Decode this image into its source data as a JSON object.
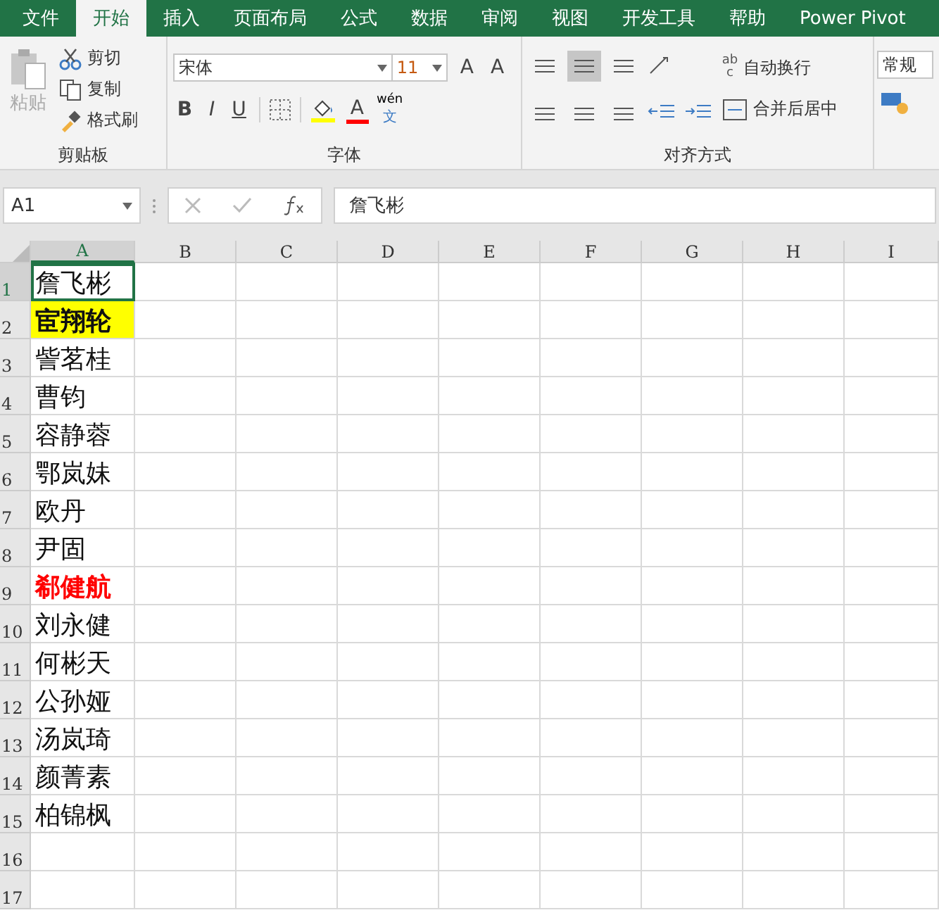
{
  "tabs": [
    {
      "label": "文件",
      "selected": false
    },
    {
      "label": "开始",
      "selected": true
    },
    {
      "label": "插入",
      "selected": false
    },
    {
      "label": "页面布局",
      "selected": false
    },
    {
      "label": "公式",
      "selected": false
    },
    {
      "label": "数据",
      "selected": false
    },
    {
      "label": "审阅",
      "selected": false
    },
    {
      "label": "视图",
      "selected": false
    },
    {
      "label": "开发工具",
      "selected": false
    },
    {
      "label": "帮助",
      "selected": false
    },
    {
      "label": "Power Pivot",
      "selected": false
    }
  ],
  "ribbon": {
    "clipboard": {
      "label": "剪贴板",
      "paste": {
        "label": "粘贴",
        "disabled": true
      },
      "cut": "剪切",
      "copy": "复制",
      "format_painter": "格式刷"
    },
    "font": {
      "label": "字体",
      "font_name": "宋体",
      "font_size": "11",
      "grow": "A",
      "shrink": "A",
      "bold": "B",
      "italic": "I",
      "underline": "U",
      "font_color": "A",
      "phonetic_top": "wén",
      "phonetic_bottom": "文"
    },
    "alignment": {
      "label": "对齐方式",
      "wrap_text": "自动换行",
      "merge_center": "合并后居中",
      "wrap_glyph_top": "ab",
      "wrap_glyph_bottom": "c"
    },
    "number": {
      "format": "常规"
    }
  },
  "name_box": "A1",
  "formula": "詹飞彬",
  "columns": [
    "A",
    "B",
    "C",
    "D",
    "E",
    "F",
    "G",
    "H",
    "I"
  ],
  "rows": [
    {
      "header": "1",
      "value": "詹飞彬",
      "kind": "plain",
      "selected": true
    },
    {
      "header": "2",
      "value": "宦翔轮",
      "kind": "highlighted",
      "selected": false
    },
    {
      "header": "3",
      "value": "訾茗桂",
      "kind": "plain",
      "selected": false
    },
    {
      "header": "4",
      "value": "曹钧",
      "kind": "plain",
      "selected": false
    },
    {
      "header": "5",
      "value": "容静蓉",
      "kind": "plain",
      "selected": false
    },
    {
      "header": "6",
      "value": "鄂岚妹",
      "kind": "plain",
      "selected": false
    },
    {
      "header": "7",
      "value": "欧丹",
      "kind": "plain",
      "selected": false
    },
    {
      "header": "8",
      "value": "尹固",
      "kind": "plain",
      "selected": false
    },
    {
      "header": "9",
      "value": "郗健航",
      "kind": "red",
      "selected": false
    },
    {
      "header": "10",
      "value": "刘永健",
      "kind": "plain",
      "selected": false
    },
    {
      "header": "11",
      "value": "何彬天",
      "kind": "plain",
      "selected": false
    },
    {
      "header": "12",
      "value": "公孙娅",
      "kind": "plain",
      "selected": false
    },
    {
      "header": "13",
      "value": "汤岚琦",
      "kind": "plain",
      "selected": false
    },
    {
      "header": "14",
      "value": "颜菁素",
      "kind": "plain",
      "selected": false
    },
    {
      "header": "15",
      "value": "柏锦枫",
      "kind": "plain",
      "selected": false
    },
    {
      "header": "16",
      "selected": false
    },
    {
      "header": "17",
      "selected": false
    }
  ]
}
